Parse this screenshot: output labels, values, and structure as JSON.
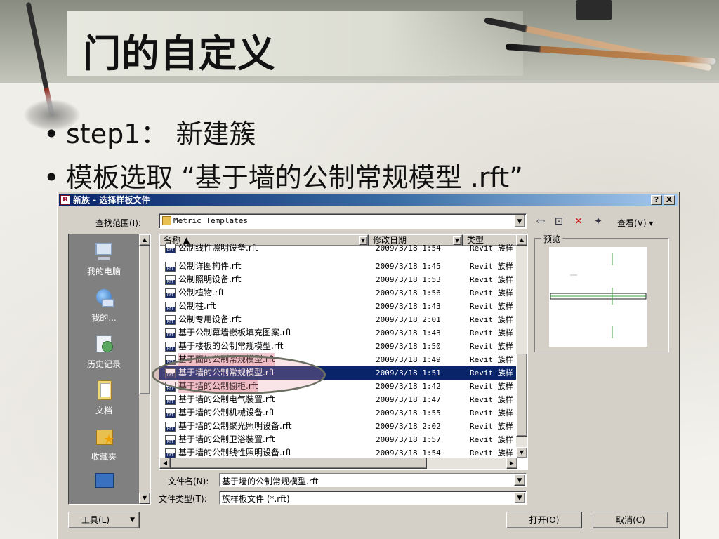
{
  "slide": {
    "title": "门的自定义",
    "bullets": [
      "step1： 新建簇",
      "模板选取 “基于墙的公制常规模型 .rft”"
    ],
    "bullet_symbol": "•"
  },
  "dialog": {
    "title": "新族 - 选择样板文件",
    "help_button": "?",
    "close_button": "X",
    "look_in_label": "查找范围(I):",
    "look_in_value": "Metric Templates",
    "view_label": "查看(V) ▾",
    "places": [
      {
        "label": "我的电脑",
        "icon": "my-computer-icon"
      },
      {
        "label": "我的...",
        "icon": "network-icon"
      },
      {
        "label": "历史记录",
        "icon": "history-icon"
      },
      {
        "label": "文档",
        "icon": "documents-icon"
      },
      {
        "label": "收藏夹",
        "icon": "favorites-icon"
      }
    ],
    "columns": {
      "name": "名称 ▲",
      "date": "修改日期",
      "type": "类型"
    },
    "files": [
      {
        "name": "公制线性照明设备.rft",
        "date": "2009/3/18 1:54",
        "type": "Revit 族样"
      },
      {
        "name": "公制详图构件.rft",
        "date": "2009/3/18 1:45",
        "type": "Revit 族样"
      },
      {
        "name": "公制照明设备.rft",
        "date": "2009/3/18 1:53",
        "type": "Revit 族样"
      },
      {
        "name": "公制植物.rft",
        "date": "2009/3/18 1:56",
        "type": "Revit 族样"
      },
      {
        "name": "公制柱.rft",
        "date": "2009/3/18 1:43",
        "type": "Revit 族样"
      },
      {
        "name": "公制专用设备.rft",
        "date": "2009/3/18 2:01",
        "type": "Revit 族样"
      },
      {
        "name": "基于公制幕墙嵌板填充图案.rft",
        "date": "2009/3/18 1:43",
        "type": "Revit 族样"
      },
      {
        "name": "基于楼板的公制常规模型.rft",
        "date": "2009/3/18 1:50",
        "type": "Revit 族样"
      },
      {
        "name": "基于面的公制常规模型.rft",
        "date": "2009/3/18 1:49",
        "type": "Revit 族样"
      },
      {
        "name": "基于墙的公制常规模型.rft",
        "date": "2009/3/18 1:51",
        "type": "Revit 族样"
      },
      {
        "name": "基于墙的公制橱柜.rft",
        "date": "2009/3/18 1:42",
        "type": "Revit 族样"
      },
      {
        "name": "基于墙的公制电气装置.rft",
        "date": "2009/3/18 1:47",
        "type": "Revit 族样"
      },
      {
        "name": "基于墙的公制机械设备.rft",
        "date": "2009/3/18 1:55",
        "type": "Revit 族样"
      },
      {
        "name": "基于墙的公制聚光照明设备.rft",
        "date": "2009/3/18 2:02",
        "type": "Revit 族样"
      },
      {
        "name": "基于墙的公制卫浴装置.rft",
        "date": "2009/3/18 1:57",
        "type": "Revit 族样"
      },
      {
        "name": "基于墙的公制线性照明设备.rft",
        "date": "2009/3/18 1:54",
        "type": "Revit 族样"
      }
    ],
    "preview_label": "预览",
    "filename_label": "文件名(N):",
    "filename_value": "基于墙的公制常规模型.rft",
    "filetype_label": "文件类型(T):",
    "filetype_value": "族样板文件 (*.rft)",
    "tools_button": "工具(L)",
    "open_button": "打开(O)",
    "cancel_button": "取消(C)"
  }
}
